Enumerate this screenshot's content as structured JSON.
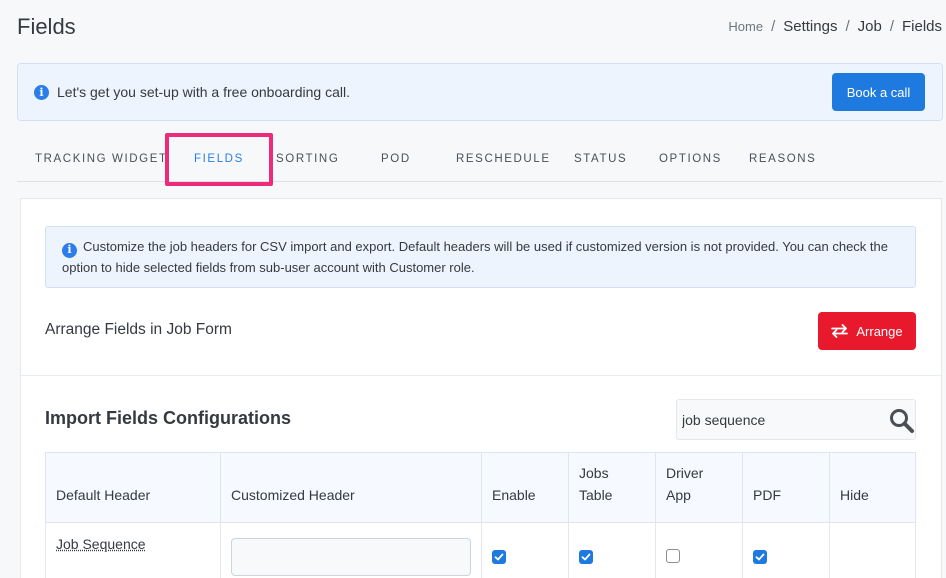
{
  "page": {
    "title": "Fields",
    "breadcrumb": [
      "Home",
      "Settings",
      "Job",
      "Fields"
    ],
    "separator": "/"
  },
  "onboarding": {
    "text": "Let's get you set-up with a free onboarding call.",
    "button": "Book a call",
    "icon": "info-icon"
  },
  "tabs": [
    {
      "label": "TRACKING WIDGET",
      "active": false
    },
    {
      "label": "FIELDS",
      "active": true
    },
    {
      "label": "SORTING",
      "active": false
    },
    {
      "label": "POD",
      "active": false
    },
    {
      "label": "RESCHEDULE",
      "active": false
    },
    {
      "label": "STATUS",
      "active": false
    },
    {
      "label": "OPTIONS",
      "active": false
    },
    {
      "label": "REASONS",
      "active": false
    }
  ],
  "notice": {
    "text": "Customize the job headers for CSV import and export. Default headers will be used if customized version is not provided. You can check the option to hide selected fields from sub-user account with Customer role."
  },
  "arrange": {
    "label": "Arrange Fields in Job Form",
    "button": "Arrange",
    "icon": "swap-arrows-icon"
  },
  "import": {
    "title": "Import Fields Configurations",
    "search_value": "job sequence",
    "search_icon": "search-icon"
  },
  "table": {
    "headers": {
      "default_header": "Default Header",
      "customized_header": "Customized Header",
      "enable": "Enable",
      "jobs_table_1": "Jobs",
      "jobs_table_2": "Table",
      "driver_app_1": "Driver",
      "driver_app_2": "App",
      "pdf": "PDF",
      "hide": "Hide"
    },
    "rows": [
      {
        "field": "Job Sequence",
        "customized_value": "",
        "enable": true,
        "jobs_table": true,
        "driver_app": false,
        "pdf": true
      }
    ]
  },
  "colors": {
    "primary": "#1f7ae0",
    "danger": "#e8192c",
    "highlight": "#ee2a7b"
  }
}
